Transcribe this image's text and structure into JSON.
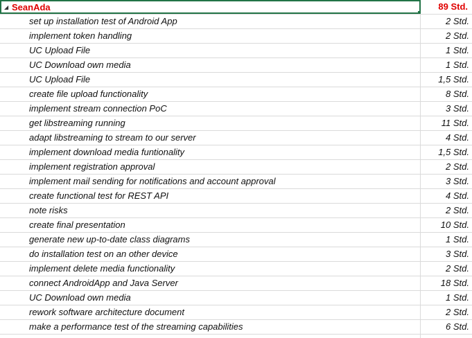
{
  "group": {
    "collapse_icon": "◢",
    "name": "SeanAda",
    "total": "89 Std."
  },
  "tasks": [
    {
      "task": "set up installation test of Android App",
      "hours": "2 Std."
    },
    {
      "task": "implement token handling",
      "hours": "2 Std."
    },
    {
      "task": "UC Upload File",
      "hours": "1 Std."
    },
    {
      "task": "UC Download own media",
      "hours": "1 Std."
    },
    {
      "task": "UC Upload File",
      "hours": "1,5 Std."
    },
    {
      "task": "create file upload functionality",
      "hours": "8 Std."
    },
    {
      "task": "implement stream connection PoC",
      "hours": "3 Std."
    },
    {
      "task": "get libstreaming running",
      "hours": "11 Std."
    },
    {
      "task": "adapt libstreaming to stream to our server",
      "hours": "4 Std."
    },
    {
      "task": "implement download media funtionality",
      "hours": "1,5 Std."
    },
    {
      "task": "implement registration approval",
      "hours": "2 Std."
    },
    {
      "task": "implement mail sending for notifications and account approval",
      "hours": "3 Std."
    },
    {
      "task": "create functional test for REST API",
      "hours": "4 Std."
    },
    {
      "task": "note risks",
      "hours": "2 Std."
    },
    {
      "task": "create final presentation",
      "hours": "10 Std."
    },
    {
      "task": "generate new up-to-date class diagrams",
      "hours": "1 Std."
    },
    {
      "task": "do installation test on an other device",
      "hours": "3 Std."
    },
    {
      "task": "implement delete media functionality",
      "hours": "2 Std."
    },
    {
      "task": "connect AndroidApp and Java Server",
      "hours": "18 Std."
    },
    {
      "task": "UC Download own media",
      "hours": "1 Std."
    },
    {
      "task": "rework software architecture document",
      "hours": "2 Std."
    },
    {
      "task": "make a performance test of the streaming capabilities",
      "hours": "6 Std."
    },
    {
      "task": "",
      "hours": ""
    }
  ]
}
